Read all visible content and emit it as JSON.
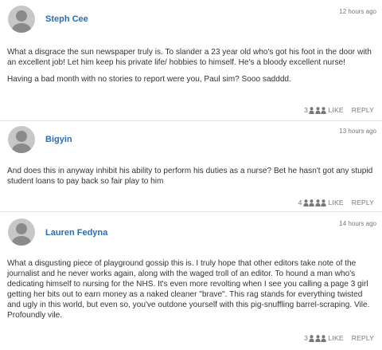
{
  "comments": [
    {
      "author": "Steph Cee",
      "time": "12 hours ago",
      "paragraphs": [
        "What a disgrace the sun newspaper truly is. To slander a 23 year old who's got his foot in the door with an excellent job! Let him keep his private life/ hobbies to himself. He's a bloody excellent nurse!",
        "Having a bad month with no stories to report were you, Paul sim? Sooo sadddd."
      ],
      "likes": "3",
      "like_label": "LIKE",
      "reply_label": "REPLY"
    },
    {
      "author": "Bigyin",
      "time": "13 hours ago",
      "paragraphs": [
        "And does this in anyway inhibit his ability to perform his duties as a nurse? Bet he hasn't got any stupid student loans to pay back so fair play to him"
      ],
      "likes": "4",
      "like_label": "LIKE",
      "reply_label": "REPLY"
    },
    {
      "author": "Lauren Fedyna",
      "time": "14 hours ago",
      "paragraphs": [
        "What a disgusting piece of playground gossip this is. I truly hope that other editors take note of the journalist and he never works again, along with the waged troll of an editor. To hound a man who's dedicating himself to nursing for the NHS. It's even more revolting when I see you calling a page 3 girl getting her bits out to earn money as a naked cleaner \"brave\". This rag stands for everything twisted and ugly in this world, but even so, you've outdone yourself with this pig-snuffling barrel-scraping. Vile. Profoundly vile."
      ],
      "likes": "3",
      "like_label": "LIKE",
      "reply_label": "REPLY"
    }
  ],
  "icons": {
    "avatar": "user-silhouette-icon",
    "like": "person-icon"
  },
  "colors": {
    "author": "#2a6db5",
    "avatar_bg": "#c7c7c7",
    "avatar_fg": "#8a8a8a",
    "muted": "#777777",
    "divider": "#e2e2e2"
  }
}
